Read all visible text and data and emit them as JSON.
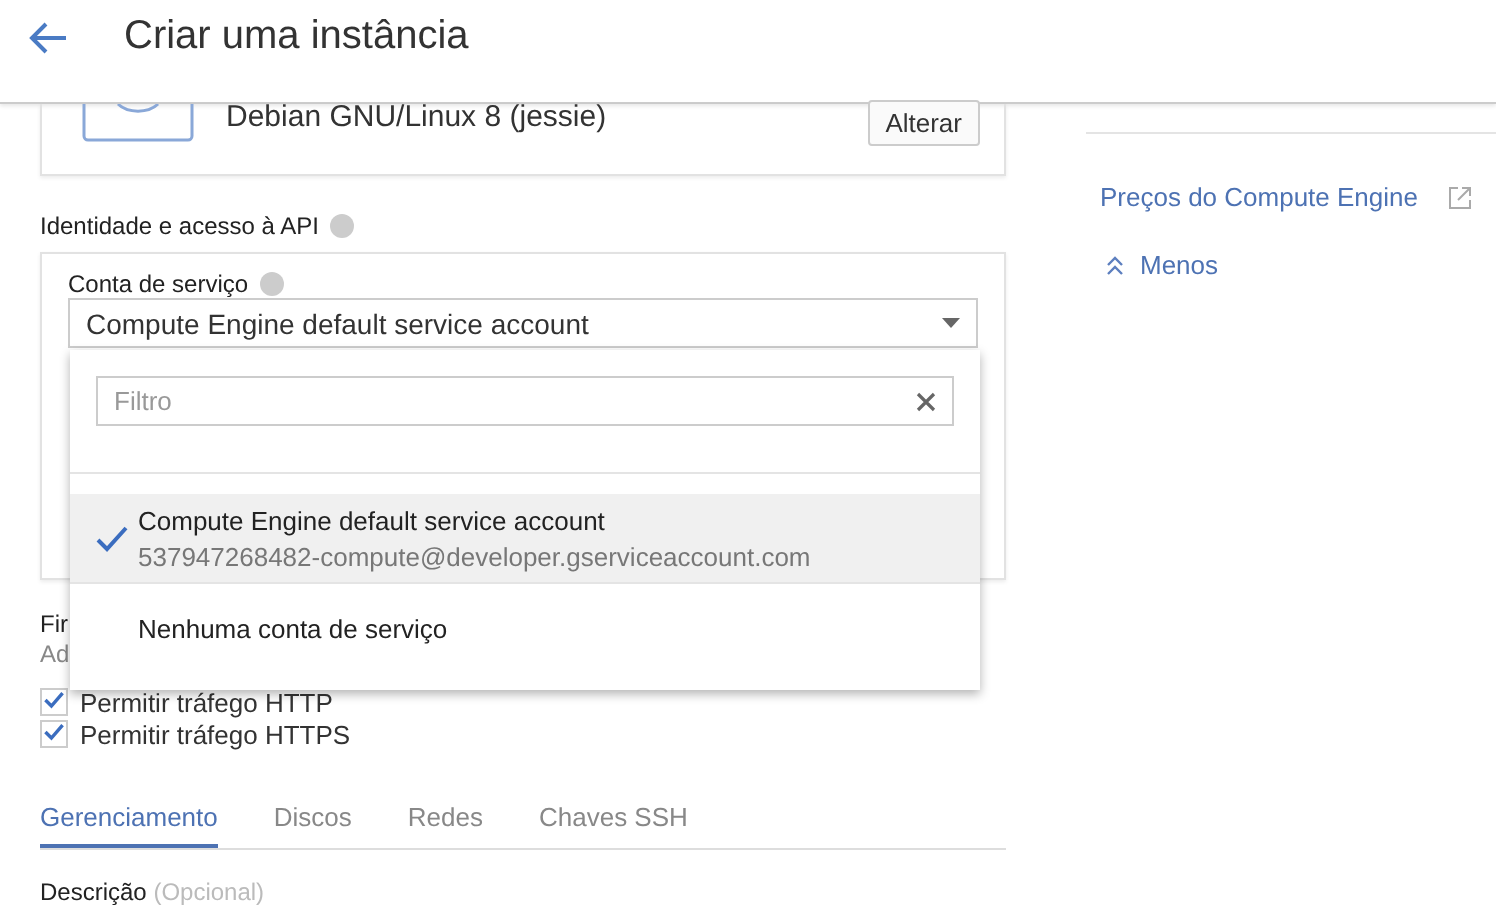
{
  "header": {
    "title": "Criar uma instância"
  },
  "boot_disk": {
    "os": "Debian GNU/Linux 8 (jessie)",
    "change_button": "Alterar"
  },
  "identity": {
    "title": "Identidade e acesso à API",
    "service_account": {
      "label": "Conta de serviço",
      "value": "Compute Engine default service account"
    }
  },
  "dropdown": {
    "filter_placeholder": "Filtro",
    "options": [
      {
        "name": "Compute Engine default service account",
        "email": "537947268482-compute@developer.gserviceaccount.com",
        "selected": true
      },
      {
        "name": "Nenhuma conta de serviço",
        "selected": false
      }
    ]
  },
  "firewall": {
    "title": "Fir",
    "subtitle": "Ad",
    "options": [
      {
        "label": "Permitir tráfego HTTP",
        "checked": true
      },
      {
        "label": "Permitir tráfego HTTPS",
        "checked": true
      }
    ]
  },
  "tabs": [
    {
      "label": "Gerenciamento",
      "selected": true
    },
    {
      "label": "Discos",
      "selected": false
    },
    {
      "label": "Redes",
      "selected": false
    },
    {
      "label": "Chaves SSH",
      "selected": false
    }
  ],
  "description": {
    "label": "Descrição",
    "hint": "(Opcional)"
  },
  "sidebar": {
    "pricing_link": "Preços do Compute Engine",
    "toggle": "Menos"
  }
}
